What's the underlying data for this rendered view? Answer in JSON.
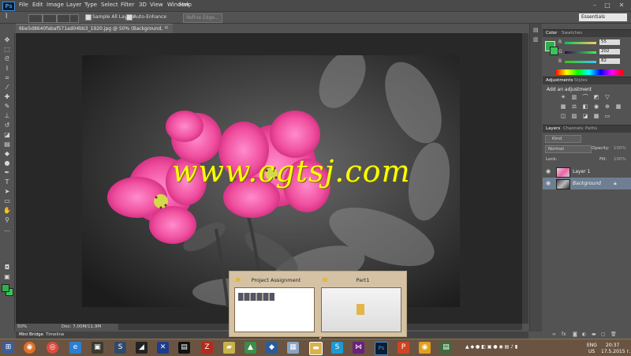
{
  "app": {
    "logo": "Ps"
  },
  "menu": [
    "File",
    "Edit",
    "Image",
    "Layer",
    "Type",
    "Select",
    "Filter",
    "3D",
    "View",
    "Window",
    "Help"
  ],
  "window_controls": {
    "minimize": "–",
    "maximize": "□",
    "close": "✕"
  },
  "options_bar": {
    "sample_all_layers": "Sample All Layers",
    "auto_enhance": "Auto-Enhance",
    "refine_edge": "Refine Edge...",
    "workspace": "Essentials"
  },
  "document": {
    "tab_title": "6be5d8640fabaf571ad04bb3_1920.jpg @ 50% (Background, RGB/8#) *",
    "close": "×",
    "watermark": "www.cgtsj.com"
  },
  "status": {
    "zoom": "50%",
    "doc": "Doc: 7,00M/11,9M"
  },
  "bottom_tabs": [
    "Mini Bridge",
    "Timeline"
  ],
  "color_panel": {
    "tabs": [
      "Color",
      "Swatches"
    ],
    "fg_color": "#2bb34a",
    "channels": [
      {
        "label": "R",
        "value": "55"
      },
      {
        "label": "G",
        "value": "202"
      },
      {
        "label": "B",
        "value": "82"
      }
    ]
  },
  "adjustments_panel": {
    "tabs": [
      "Adjustments",
      "Styles"
    ],
    "heading": "Add an adjustment"
  },
  "layers_panel": {
    "tabs": [
      "Layers",
      "Channels",
      "Paths"
    ],
    "kind_label": "Kind",
    "blend_mode": "Normal",
    "opacity_label": "Opacity:",
    "opacity_value": "100%",
    "lock_label": "Lock:",
    "fill_label": "Fill:",
    "fill_value": "100%",
    "layers": [
      {
        "name": "Layer 1"
      },
      {
        "name": "Background"
      }
    ]
  },
  "popup": {
    "cards": [
      {
        "title": "Project Assignment"
      },
      {
        "title": "Part1"
      }
    ]
  },
  "taskbar": {
    "tray": {
      "lang": "ENG",
      "region": "US",
      "time": "20:37",
      "date": "17.5.2015 г."
    }
  },
  "accent_colors": {
    "ps_blue": "#3e8ee0",
    "taskbar": "#6a5441",
    "watermark": "#ffff00",
    "flower_pink": "#e8449a"
  }
}
